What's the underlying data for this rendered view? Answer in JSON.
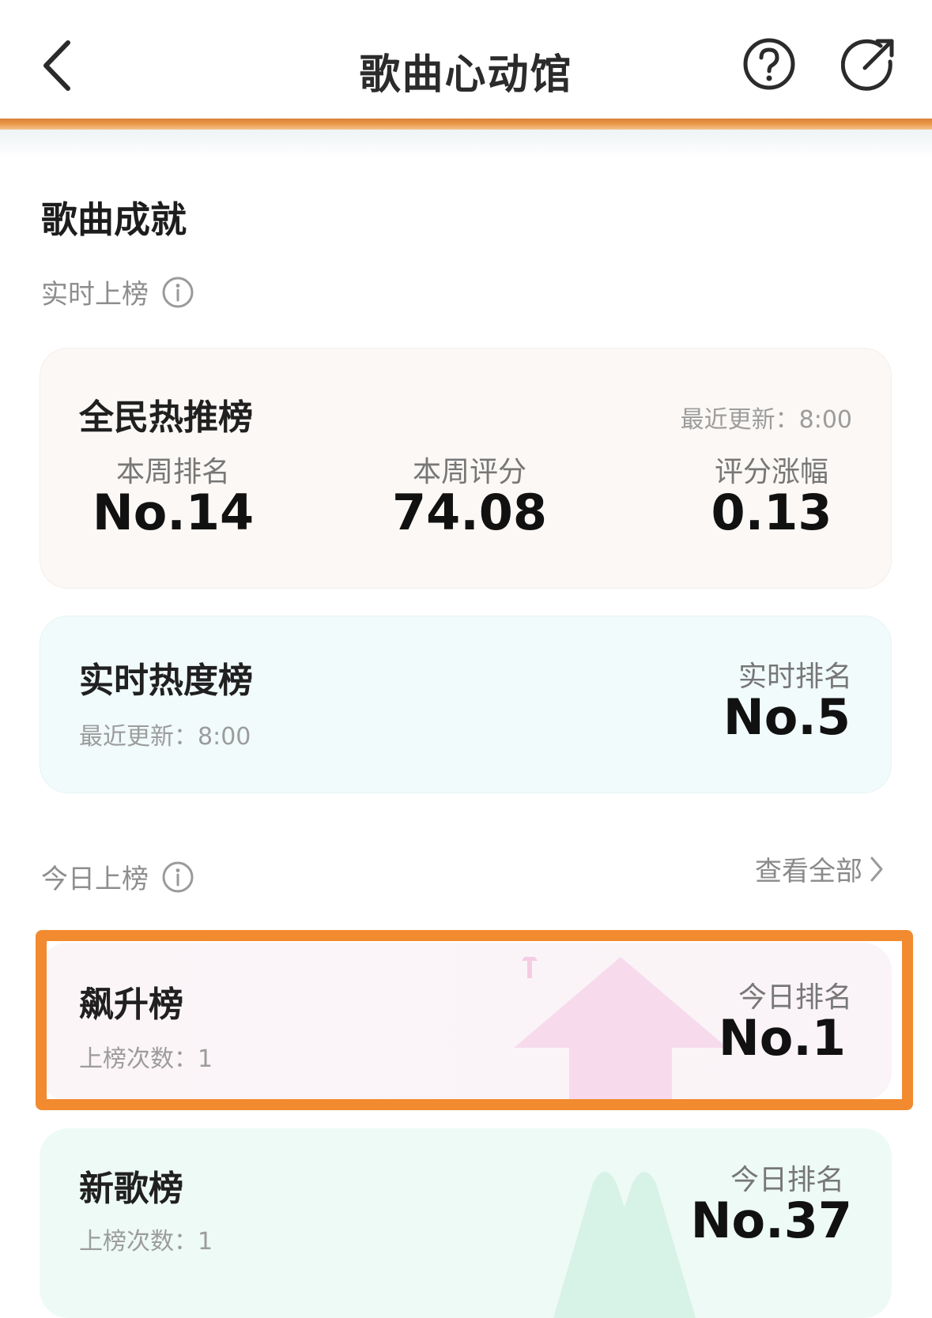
{
  "header": {
    "title": "歌曲心动馆"
  },
  "achievements": {
    "title": "歌曲成就",
    "realtime_label": "实时上榜",
    "today_label": "今日上榜",
    "see_all": "查看全部"
  },
  "hot_recommend": {
    "title": "全民热推榜",
    "updated": "最近更新：8:00",
    "metrics": [
      {
        "label": "本周排名",
        "value": "No.14"
      },
      {
        "label": "本周评分",
        "value": "74.08"
      },
      {
        "label": "评分涨幅",
        "value": "0.13"
      }
    ]
  },
  "realtime_hot": {
    "title": "实时热度榜",
    "updated": "最近更新：8:00",
    "rank_label": "实时排名",
    "rank": "No.5"
  },
  "rising": {
    "title": "飙升榜",
    "count": "上榜次数：1",
    "rank_label": "今日排名",
    "rank": "No.1"
  },
  "new_songs": {
    "title": "新歌榜",
    "count": "上榜次数：1",
    "rank_label": "今日排名",
    "rank": "No.37"
  },
  "colors": {
    "accent": "#f28a2f",
    "card_warm": "#fbf8f6",
    "card_teal": "#f1fbfb",
    "card_pink": "#fbf5f8",
    "card_green": "#eefaf5"
  }
}
